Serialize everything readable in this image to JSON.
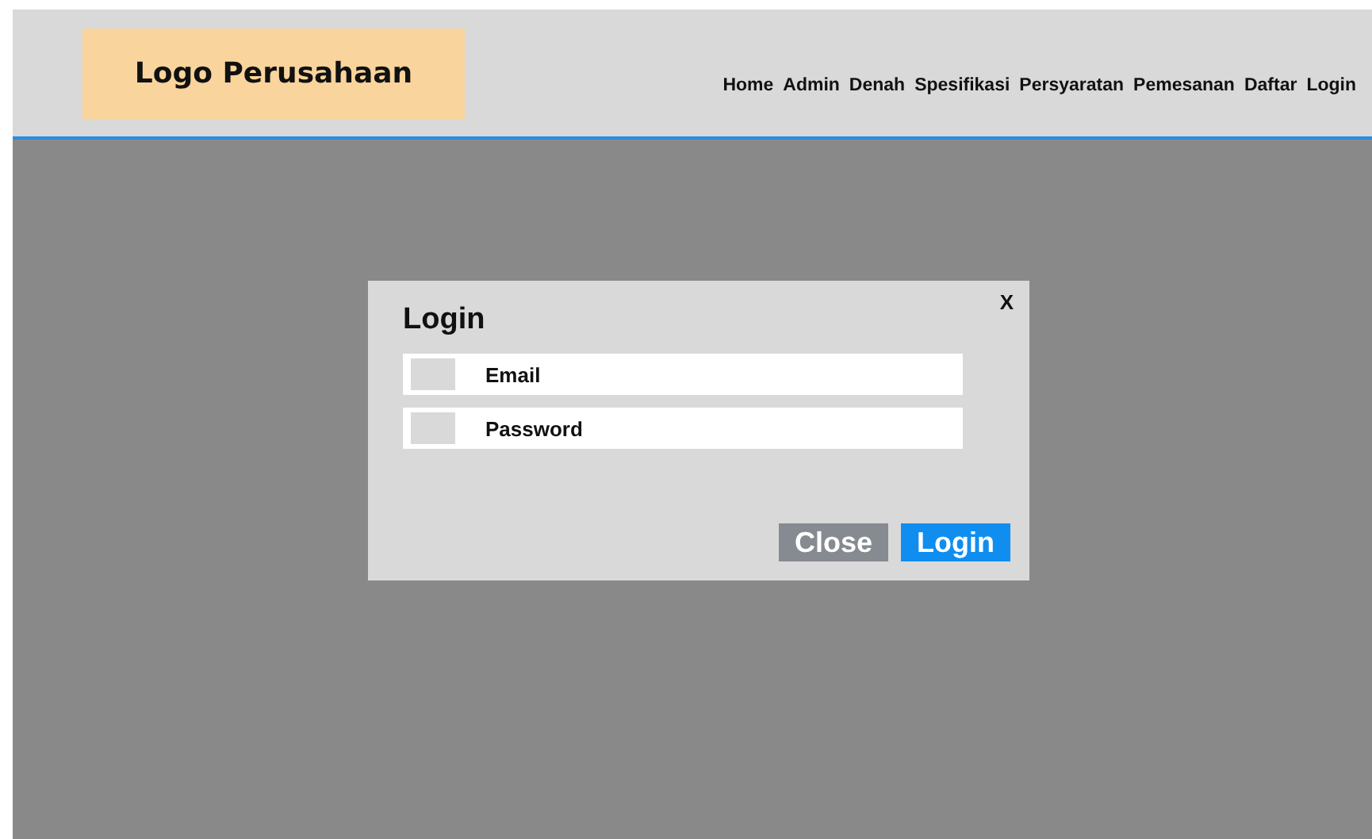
{
  "header": {
    "logo": "Logo Perusahaan",
    "nav": [
      "Home",
      "Admin",
      "Denah",
      "Spesifikasi",
      "Persyaratan",
      "Pemesanan",
      "Daftar",
      "Login"
    ]
  },
  "dialog": {
    "title": "Login",
    "close_icon": "X",
    "fields": [
      {
        "placeholder": "Email"
      },
      {
        "placeholder": "Password"
      }
    ],
    "buttons": [
      {
        "label": "Close",
        "kind": "secondary"
      },
      {
        "label": "Login",
        "kind": "primary"
      }
    ]
  }
}
